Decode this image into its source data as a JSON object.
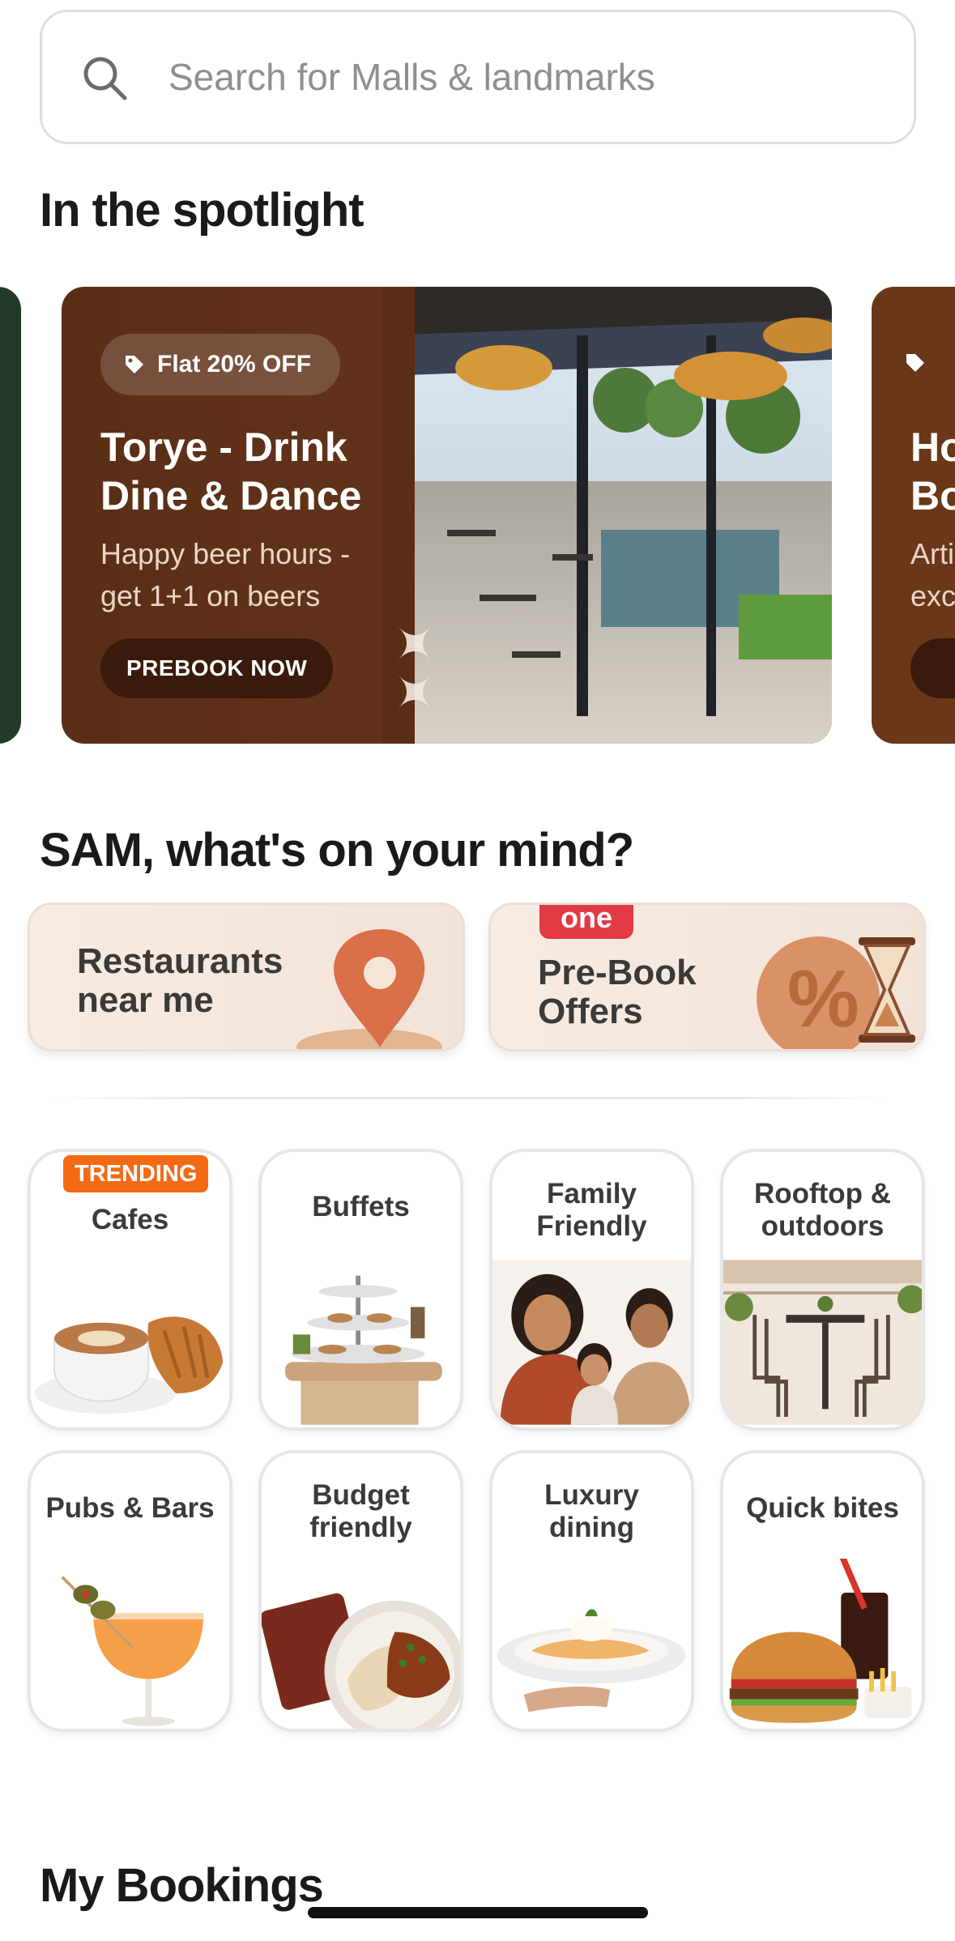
{
  "search": {
    "placeholder": "Search for  Malls & landmarks",
    "icon": "search-icon"
  },
  "spotlight": {
    "title": "In the spotlight",
    "main_banner": {
      "badge": "Flat 20% OFF",
      "title": "Torye - Drink Dine & Dance",
      "subtitle": "Happy beer hours - get 1+1 on beers",
      "cta": "PREBOOK NOW",
      "bg_color": "#5a2e16"
    },
    "next_banner": {
      "title": "Ho\nBo",
      "subtitle": "Arti\nexc"
    }
  },
  "mind": {
    "title": "SAM, what's on your mind?",
    "cards": [
      {
        "label": "Restaurants near me",
        "icon": "map-pin-icon"
      },
      {
        "label": "Pre-Book Offers",
        "tag": "one",
        "icon": "discount-hourglass-icon"
      }
    ]
  },
  "categories": [
    {
      "label": "Cafes",
      "tag": "TRENDING"
    },
    {
      "label": "Buffets"
    },
    {
      "label": "Family Friendly"
    },
    {
      "label": "Rooftop & outdoors"
    },
    {
      "label": "Pubs & Bars"
    },
    {
      "label": "Budget friendly"
    },
    {
      "label": "Luxury dining"
    },
    {
      "label": "Quick bites"
    }
  ],
  "bookings": {
    "title": "My Bookings"
  },
  "colors": {
    "accent_orange": "#f46a14",
    "tag_red": "#e23a44",
    "banner_brown": "#5a2e16"
  }
}
